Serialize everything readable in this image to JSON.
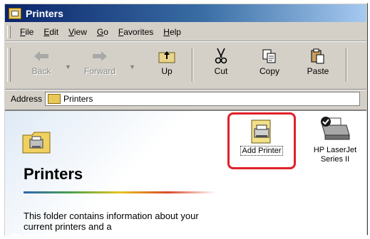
{
  "window": {
    "title": "Printers"
  },
  "menu": [
    "File",
    "Edit",
    "View",
    "Go",
    "Favorites",
    "Help"
  ],
  "toolbar": {
    "back": "Back",
    "forward": "Forward",
    "up": "Up",
    "cut": "Cut",
    "copy": "Copy",
    "paste": "Paste"
  },
  "address": {
    "label": "Address",
    "value": "Printers"
  },
  "sidebar": {
    "title": "Printers",
    "description": "This folder contains information about your current printers and a"
  },
  "items": [
    {
      "label": "Add Printer"
    },
    {
      "label": "HP LaserJet Series II"
    }
  ],
  "colors": {
    "highlight": "#e0202a",
    "titlebar": "#0a246a"
  }
}
